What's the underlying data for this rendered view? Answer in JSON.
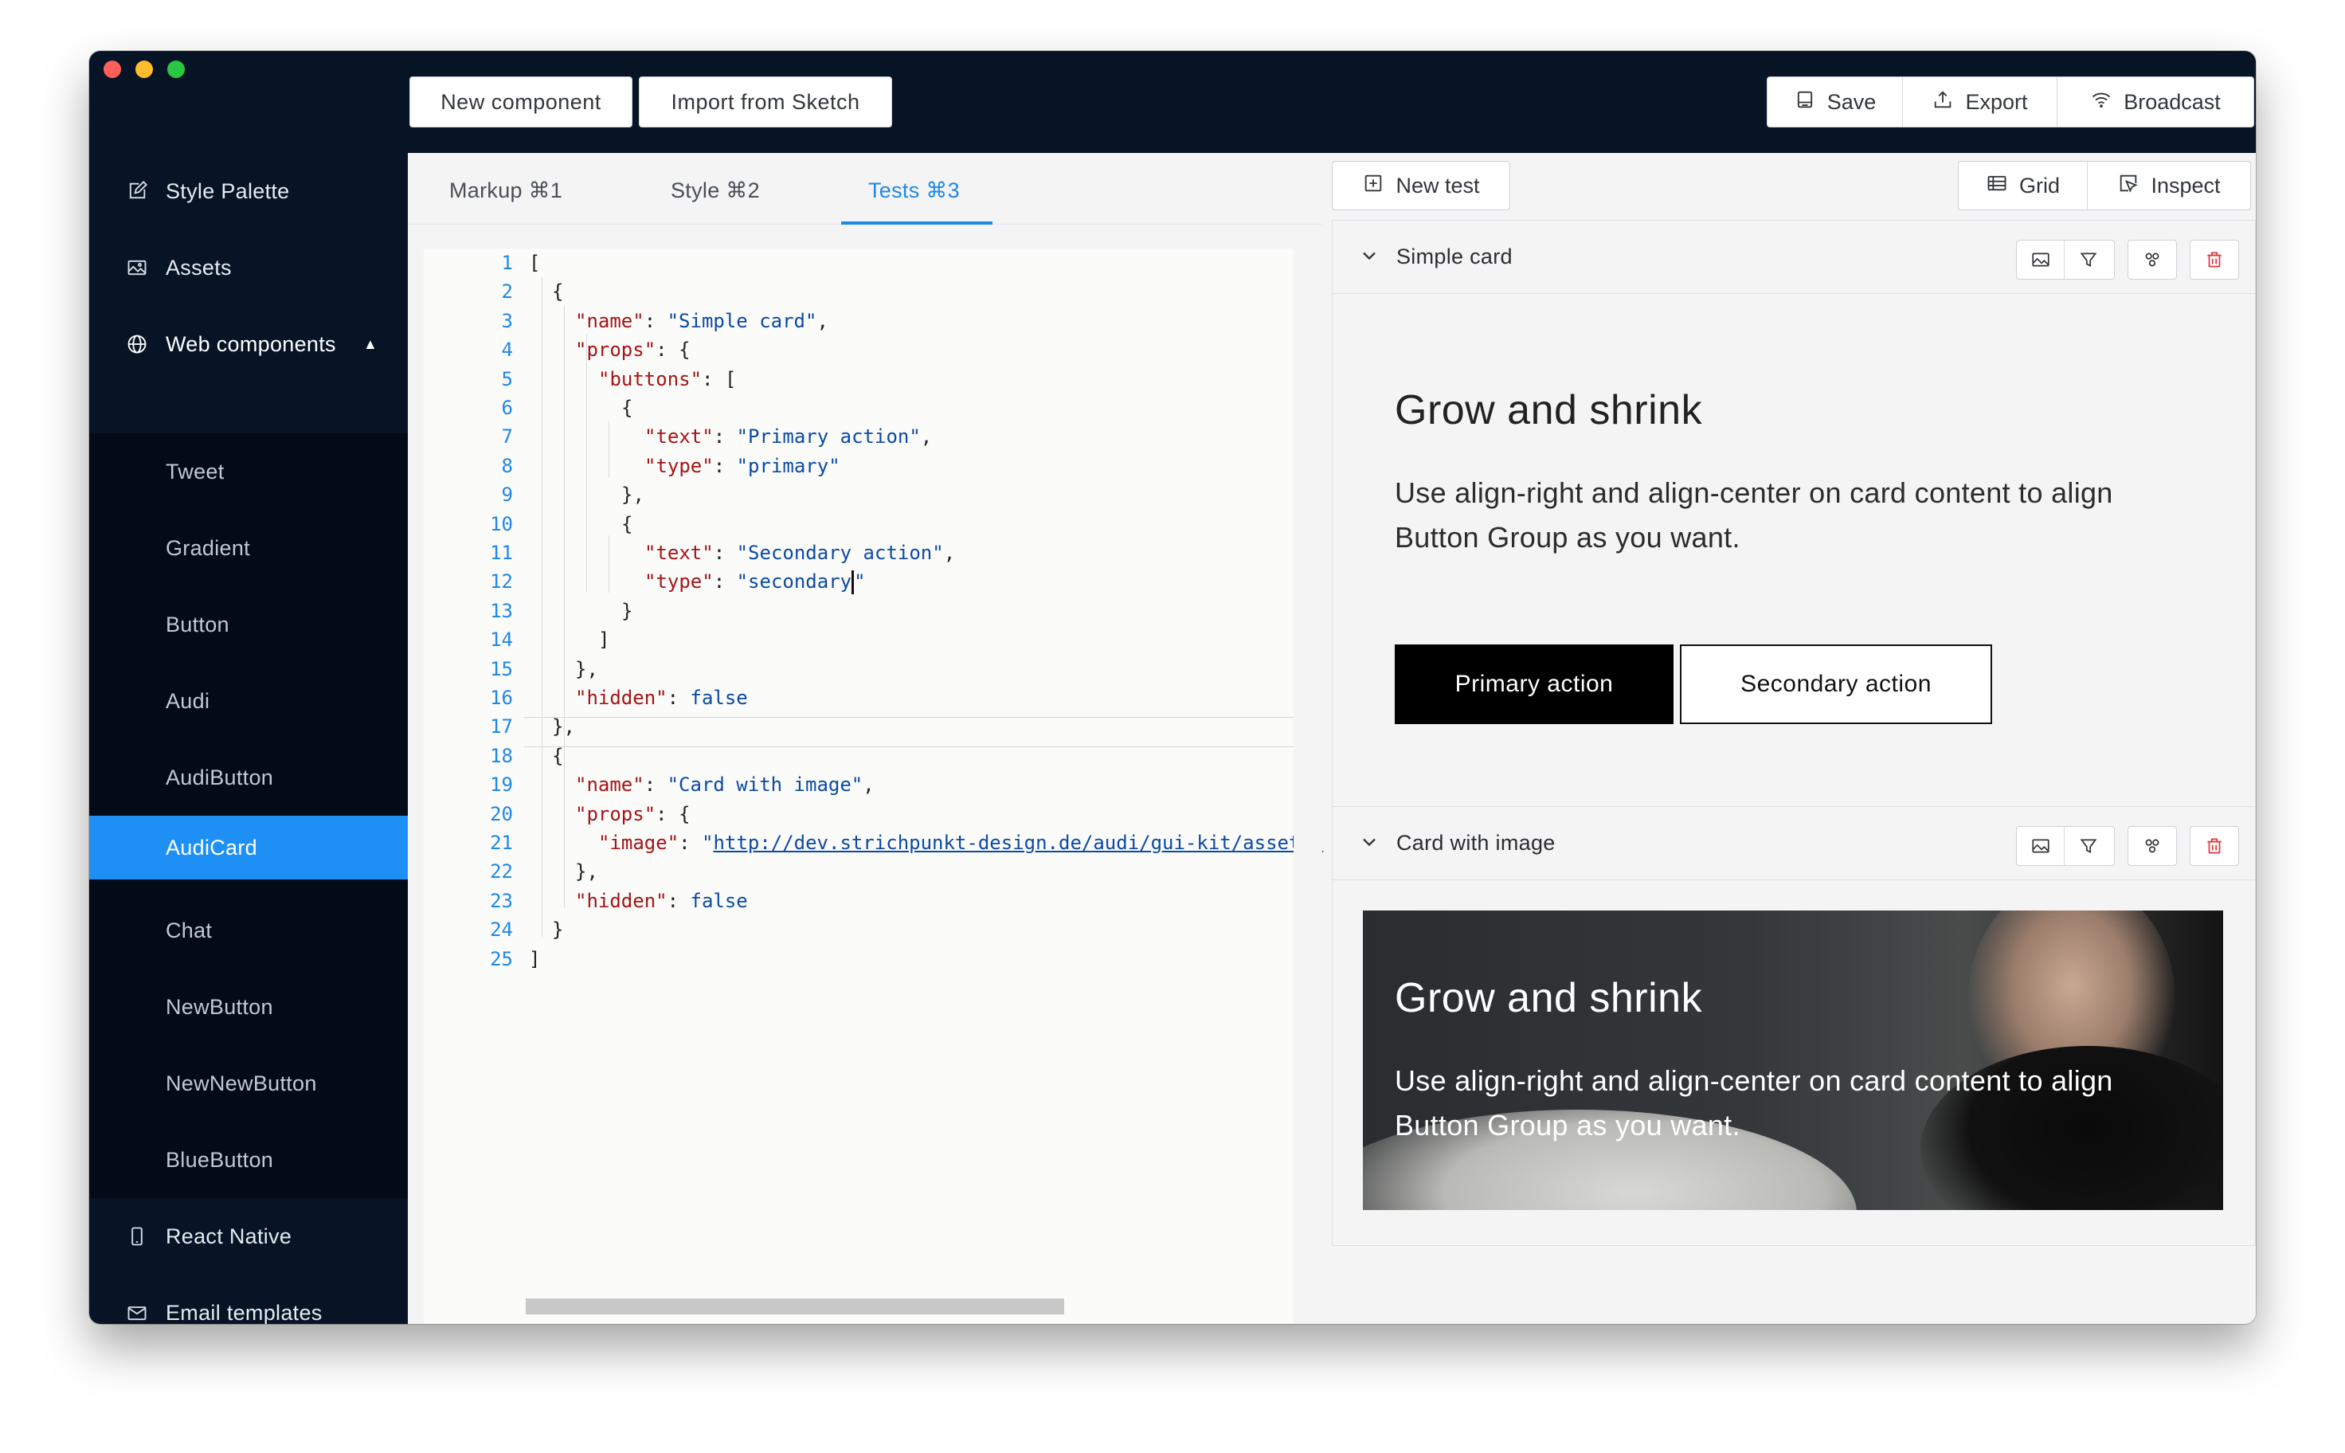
{
  "colors": {
    "chrome_dark": "#061426",
    "sidebar_sub": "#020b17",
    "accent": "#1e90f5",
    "tab_active": "#1e88e5",
    "danger": "#e0343c"
  },
  "toolbar": {
    "left_buttons": [
      "New component",
      "Import from Sketch"
    ],
    "right_buttons": [
      {
        "label": "Save",
        "icon": "save-icon"
      },
      {
        "label": "Export",
        "icon": "upload-icon"
      },
      {
        "label": "Broadcast",
        "icon": "wifi-icon"
      }
    ]
  },
  "sidebar": {
    "items": [
      {
        "label": "Style Palette",
        "icon": "edit-icon"
      },
      {
        "label": "Assets",
        "icon": "image-icon"
      },
      {
        "label": "Web components",
        "icon": "globe-icon",
        "expanded": true
      },
      {
        "label": "React Native",
        "icon": "mobile-icon"
      },
      {
        "label": "Email templates",
        "icon": "mail-icon"
      }
    ],
    "sub_items": [
      "Tweet",
      "Gradient",
      "Button",
      "Audi",
      "AudiButton",
      "AudiCard",
      "Chat",
      "NewButton",
      "NewNewButton",
      "BlueButton"
    ],
    "selected": "AudiCard"
  },
  "editor": {
    "tabs": [
      "Markup ⌘1",
      "Style ⌘2",
      "Tests ⌘3"
    ],
    "active_tab": "Tests ⌘3",
    "line_numbers": [
      "1",
      "2",
      "3",
      "4",
      "5",
      "6",
      "7",
      "8",
      "9",
      "10",
      "11",
      "12",
      "13",
      "14",
      "15",
      "16",
      "17",
      "18",
      "19",
      "20",
      "21",
      "22",
      "23",
      "24",
      "25"
    ],
    "tokens": {
      "bracket_open": "[",
      "bracket_close": "]",
      "brace_open": "{",
      "brace_close": "}",
      "brace_close_comma": "},",
      "colon": ": ",
      "comma": ",",
      "k_name": "\"name\"",
      "k_props": "\"props\"",
      "k_buttons": "\"buttons\"",
      "k_text": "\"text\"",
      "k_type": "\"type\"",
      "k_hidden": "\"hidden\"",
      "k_image": "\"image\"",
      "v_simple_card": "\"Simple card\"",
      "v_primary_action": "\"Primary action\"",
      "v_primary": "\"primary\"",
      "v_secondary_action": "\"Secondary action\"",
      "v_secondary": "\"secondary",
      "v_secondary_end": "\"",
      "v_card_with_image": "\"Card with image\"",
      "v_false": "false",
      "v_url_quote": "\"",
      "v_url": "http://dev.strichpunkt-design.de/audi/gui-kit/assets/"
    }
  },
  "preview": {
    "new_test_label": "New test",
    "view_buttons": [
      {
        "label": "Grid",
        "icon": "grid-icon"
      },
      {
        "label": "Inspect",
        "icon": "inspect-icon"
      }
    ],
    "tests": [
      {
        "name": "Simple card",
        "title": "Grow and shrink",
        "body": "Use align-right and align-center on card content to align Button Group as you want.",
        "primary_button": "Primary action",
        "secondary_button": "Secondary action"
      },
      {
        "name": "Card with image",
        "title": "Grow and shrink",
        "body": "Use align-right and align-center on card content to align Button Group as you want."
      }
    ]
  }
}
